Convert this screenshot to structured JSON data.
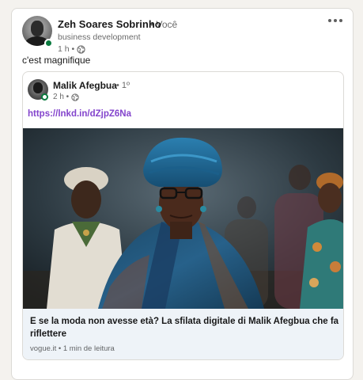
{
  "post": {
    "author": {
      "name": "Zeh Soares Sobrinho",
      "relation": "• Você",
      "headline": "business development",
      "time": "1 h •",
      "avatar_icon": "person-avatar",
      "presence": "online"
    },
    "menu_icon": "more-horizontal-icon",
    "commentary": "c'est magnifique",
    "shared": {
      "author": {
        "name": "Malik Afegbua",
        "relation": "• 1º",
        "time": "2 h •",
        "avatar_icon": "person-avatar"
      },
      "link": "https://lnkd.in/dZjpZ6Na",
      "article": {
        "title": "E se la moda non avesse età? La sfilata digitale di Malik Afegbua che fa riflettere",
        "source": "vogue.it",
        "read_time": "• 1 min de leitura"
      }
    }
  },
  "colors": {
    "link": "#8344cc",
    "presence": "#0a7a3e",
    "footer_bg": "#eef3f8"
  }
}
